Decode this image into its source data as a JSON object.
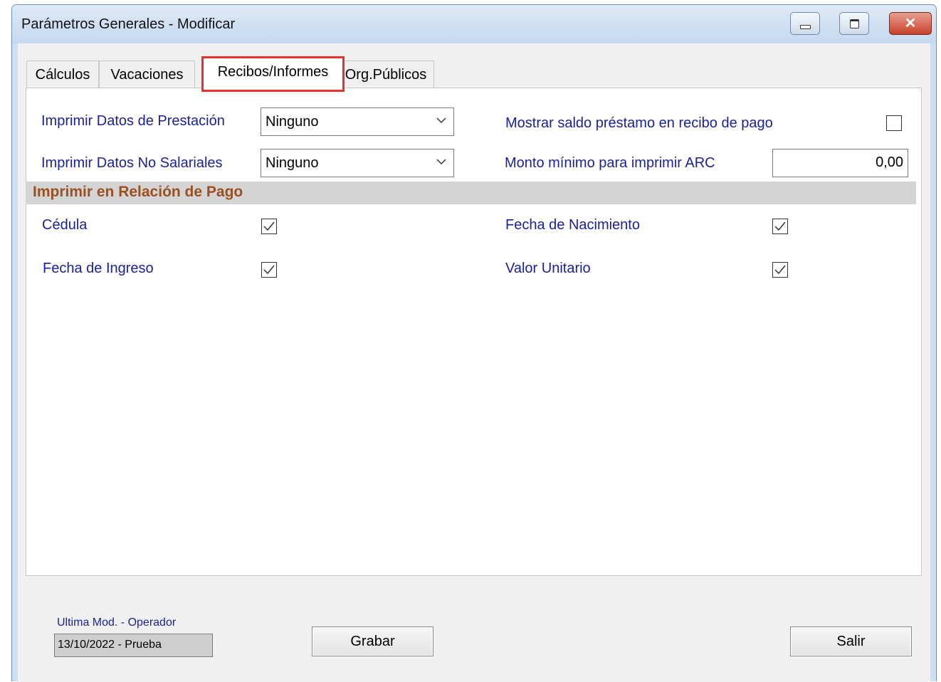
{
  "window": {
    "title": "Parámetros Generales - Modificar",
    "close_glyph": "✕",
    "controls": [
      "minimize-icon",
      "maximize-icon",
      "close-icon"
    ]
  },
  "tabs": [
    {
      "label": "Cálculos",
      "active": false
    },
    {
      "label": "Vacaciones",
      "active": false
    },
    {
      "label": "Recibos/Informes",
      "active": true
    },
    {
      "label": "Org.Públicos",
      "active": false
    }
  ],
  "fields": {
    "datos_prestacion": {
      "label": "Imprimir Datos de Prestación",
      "value": "Ninguno"
    },
    "datos_no_salariales": {
      "label": "Imprimir Datos No Salariales",
      "value": "Ninguno"
    },
    "mostrar_saldo": {
      "label": "Mostrar saldo préstamo en recibo de pago",
      "checked": false
    },
    "monto_minimo": {
      "label": "Monto mínimo para imprimir ARC",
      "value": "0,00"
    }
  },
  "section": {
    "title": "Imprimir en Relación de Pago",
    "items": [
      {
        "label": "Cédula",
        "checked": true
      },
      {
        "label": "Fecha de Nacimiento",
        "checked": true
      },
      {
        "label": "Fecha de Ingreso",
        "checked": true
      },
      {
        "label": "Valor Unitario",
        "checked": true
      }
    ]
  },
  "footer": {
    "last_mod_label": "Ultima Mod. - Operador",
    "last_mod_value": "13/10/2022 - Prueba",
    "save_label": "Grabar",
    "exit_label": "Salir"
  },
  "colors": {
    "label_blue": "#1a1f9c",
    "section_title": "#9b5021",
    "tab_highlight": "#e2332f"
  }
}
